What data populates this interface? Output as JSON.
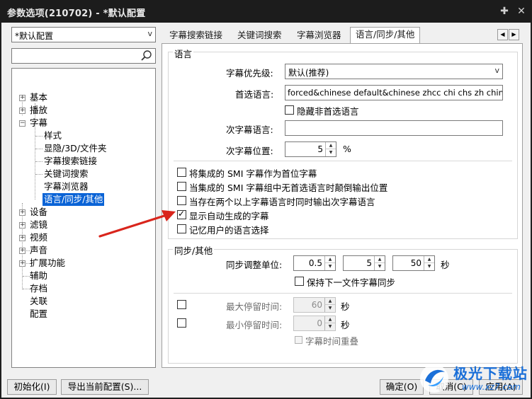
{
  "window": {
    "title": "参数选项(210702) - *默认配置",
    "pin_glyph": "✚",
    "close_glyph": "✕"
  },
  "left": {
    "profile_value": "*默认配置",
    "profile_arrow": "v",
    "search_value": "",
    "tree": {
      "basic": "基本",
      "playback": "播放",
      "subtitle": "字幕",
      "style": "样式",
      "show_hide": "显隐/3D/文件夹",
      "sub_search_links": "字幕搜索链接",
      "keyword_search": "关键词搜索",
      "sub_browser": "字幕浏览器",
      "lang_sync_other": "语言/同步/其他",
      "device": "设备",
      "filter": "滤镜",
      "video": "视频",
      "audio": "声音",
      "extensions": "扩展功能",
      "assist": "辅助",
      "archive": "存档",
      "association": "关联",
      "config": "配置"
    }
  },
  "tabs": [
    "字幕搜索链接",
    "关键词搜索",
    "字幕浏览器",
    "语言/同步/其他"
  ],
  "tabnav": {
    "prev": "◀",
    "next": "▶"
  },
  "language": {
    "group_title": "语言",
    "priority_label": "字幕优先级:",
    "priority_value": "默认(推荐)",
    "preferred_label": "首选语言:",
    "preferred_value": "forced&chinese default&chinese zhcc chi chs zh chinese",
    "hide_non_preferred": "隐藏非首选语言",
    "secondary_label": "次字幕语言:",
    "secondary_value": "",
    "secondary_pos_label": "次字幕位置:",
    "secondary_pos_value": "5",
    "secondary_pos_unit": "%",
    "options": [
      {
        "label": "将集成的 SMI 字幕作为首位字幕",
        "checked": false
      },
      {
        "label": "当集成的 SMI 字幕组中无首选语言时颠倒输出位置",
        "checked": false
      },
      {
        "label": "当存在两个以上字幕语言时同时输出次字幕语言",
        "checked": false
      },
      {
        "label": "显示自动生成的字幕",
        "checked": true
      },
      {
        "label": "记忆用户的语言选择",
        "checked": false
      }
    ]
  },
  "sync": {
    "group_title": "同步/其他",
    "step_label": "同步调整单位:",
    "step_values": [
      "0.5",
      "5",
      "50"
    ],
    "step_unit": "秒",
    "keep_sync": "保持下一文件字幕同步",
    "max_label": "最大停留时间:",
    "max_value": "60",
    "min_label": "最小停留时间:",
    "min_value": "0",
    "sec_unit": "秒",
    "overlap": "字幕时间重叠"
  },
  "buttons": {
    "init": "初始化(I)",
    "export": "导出当前配置(S)...",
    "ok": "确定(O)",
    "cancel": "取消(C)",
    "apply": "应用(A)"
  },
  "watermark": {
    "brand": "极光下载站",
    "url": "www.xz7.com"
  },
  "colors": {
    "selection": "#0a63d6",
    "arrow": "#d9251c",
    "titlebar": "#1c1c1c"
  }
}
